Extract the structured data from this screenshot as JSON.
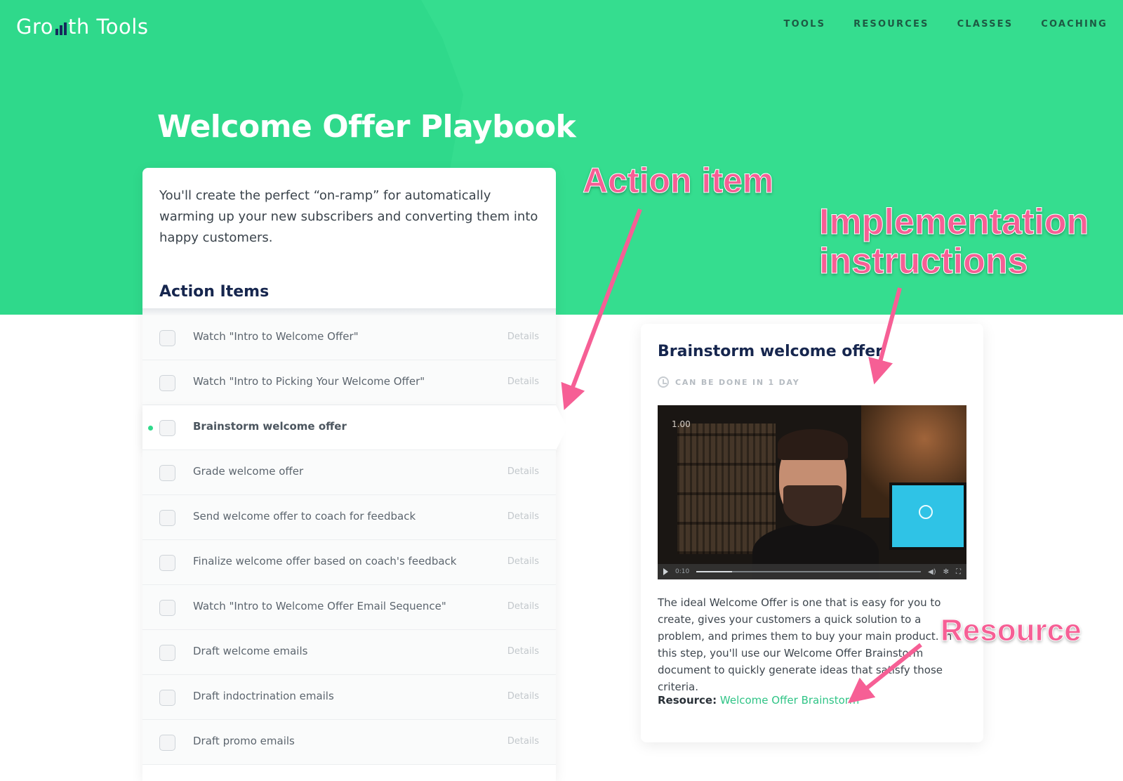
{
  "brand": {
    "logo_prefix": "Gro",
    "logo_suffix": "th Tools",
    "logo_icon": "bar-chart-icon"
  },
  "nav": [
    "TOOLS",
    "RESOURCES",
    "CLASSES",
    "COACHING"
  ],
  "page_title": "Welcome Offer Playbook",
  "intro": "You'll create the perfect “on-ramp” for automatically warming up your new subscribers and converting them into happy customers.",
  "action_items_heading": "Action Items",
  "details_label": "Details",
  "items": [
    {
      "label": "Watch \"Intro to Welcome Offer\""
    },
    {
      "label": "Watch \"Intro to Picking Your Welcome Offer\""
    },
    {
      "label": "Brainstorm welcome offer"
    },
    {
      "label": "Grade welcome offer"
    },
    {
      "label": "Send welcome offer to coach for feedback"
    },
    {
      "label": "Finalize welcome offer based on coach's feedback"
    },
    {
      "label": "Watch \"Intro to Welcome Offer Email Sequence\""
    },
    {
      "label": "Draft welcome emails"
    },
    {
      "label": "Draft indoctrination emails"
    },
    {
      "label": "Draft promo emails"
    }
  ],
  "active_item_index": 2,
  "detail": {
    "title": "Brainstorm welcome offer",
    "duration": "CAN BE DONE IN 1 DAY",
    "video": {
      "speed": "1.00",
      "time": "0:10",
      "progress": 0.16
    },
    "body": "The ideal Welcome Offer is one that is easy for you to create, gives your customers a quick solution to a problem, and primes them to buy your main product. In this step, you'll use our Welcome Offer Brainstorm document to quickly generate ideas that satisfy those criteria.",
    "resource_label": "Resource:",
    "resource_link": "Welcome Offer Brainstorm"
  },
  "annotations": {
    "action_item": "Action item",
    "implementation_1": "Implementation",
    "implementation_2": "instructions",
    "resource": "Resource"
  },
  "colors": {
    "accent": "#2fd98b",
    "annotation": "#f65f95",
    "heading": "#16264e"
  }
}
